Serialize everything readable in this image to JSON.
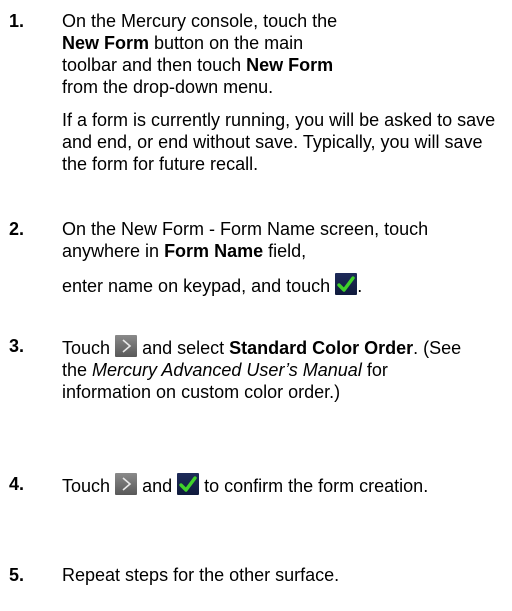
{
  "steps": [
    {
      "number": "1.",
      "p1_pre": "On the Mercury console, touch the ",
      "p1_b1": "New Form",
      "p1_mid": " button on the main toolbar and then touch ",
      "p1_b2": "New Form",
      "p1_post": " from the drop-down menu.",
      "p2": "If a form is currently running, you will be asked to save and end, or end without save. Typically, you will save the form for future recall."
    },
    {
      "number": "2.",
      "pre": "On the New Form - Form Name screen, touch anywhere in ",
      "bold": "Form Name",
      "mid": " field,",
      "line2": "enter name on keypad, and touch",
      "end": "."
    },
    {
      "number": "3.",
      "pre": "Touch",
      "mid": " and select ",
      "bold": "Standard Color Order",
      "post1": ". (See the ",
      "italic": "Mercury Advanced User’s Manual",
      "post2": " for information on custom color order.)"
    },
    {
      "number": "4.",
      "pre": "Touch",
      "mid": " and ",
      "post": " to confirm the form creation."
    },
    {
      "number": "5.",
      "text": "Repeat steps for the other surface."
    }
  ],
  "icons": {
    "next": "chevron-right-icon",
    "confirm": "checkmark-icon"
  },
  "colors": {
    "check": "#3fd12a",
    "next_bg": "#6e6e6e"
  }
}
